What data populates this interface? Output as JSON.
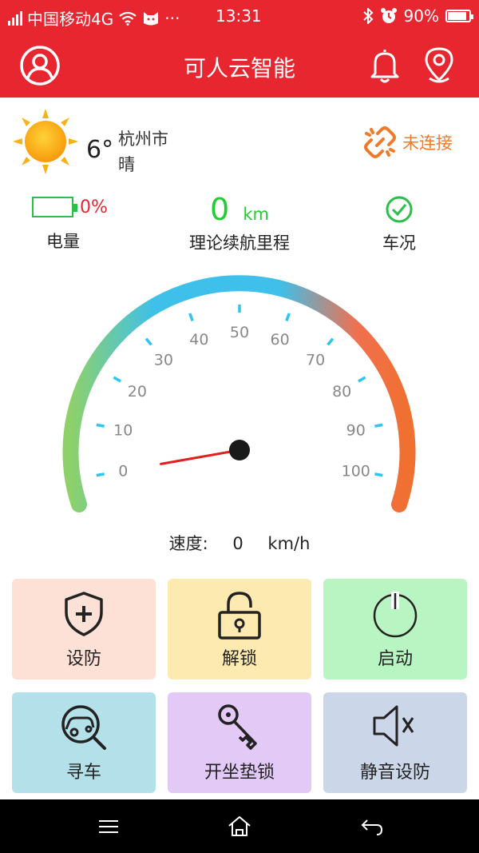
{
  "status_bar": {
    "carrier": "中国移动4G",
    "time": "13:31",
    "battery": "90%",
    "battery_level": 0.9,
    "dots": "···"
  },
  "header": {
    "title": "可人云智能",
    "icons": [
      "user-icon",
      "bell-icon",
      "location-pin-icon"
    ]
  },
  "weather": {
    "temp": "6°",
    "city": "杭州市",
    "condition": "晴",
    "icon": "sun-icon"
  },
  "connection": {
    "status": "未连接",
    "icon": "broken-link-icon",
    "color": "#f07a2b"
  },
  "stats": {
    "battery_value": "0%",
    "battery_label": "电量",
    "range_value": "0",
    "range_unit": "km",
    "range_label": "理论续航里程",
    "condition_label": "车况",
    "colors": {
      "battery_value": "#e8262f",
      "range": "#22cc33",
      "condition": "#2bbf4a"
    }
  },
  "gauge": {
    "ticks": [
      "0",
      "10",
      "20",
      "30",
      "40",
      "50",
      "60",
      "70",
      "80",
      "90",
      "100"
    ],
    "min": 0,
    "max": 100,
    "value": 0,
    "colors": {
      "low": "#8ed16a",
      "mid": "#3ec0ea",
      "high": "#f07030",
      "needle": "#e02020"
    }
  },
  "speed": {
    "label": "速度:",
    "value": "0",
    "unit": "km/h"
  },
  "actions": [
    {
      "label": "设防",
      "icon": "shield-plus-icon",
      "bg": "#fde0d6"
    },
    {
      "label": "解锁",
      "icon": "unlock-icon",
      "bg": "#fdeab1"
    },
    {
      "label": "启动",
      "icon": "power-icon",
      "bg": "#b9f5c2"
    },
    {
      "label": "寻车",
      "icon": "find-car-icon",
      "bg": "#b4e0e9"
    },
    {
      "label": "开坐垫锁",
      "icon": "key-icon",
      "bg": "#e3c9f6"
    },
    {
      "label": "静音设防",
      "icon": "mute-icon",
      "bg": "#cbd7e9"
    }
  ],
  "nav": [
    "menu-icon",
    "home-icon",
    "back-icon"
  ],
  "theme": {
    "primary": "#e8262f"
  }
}
